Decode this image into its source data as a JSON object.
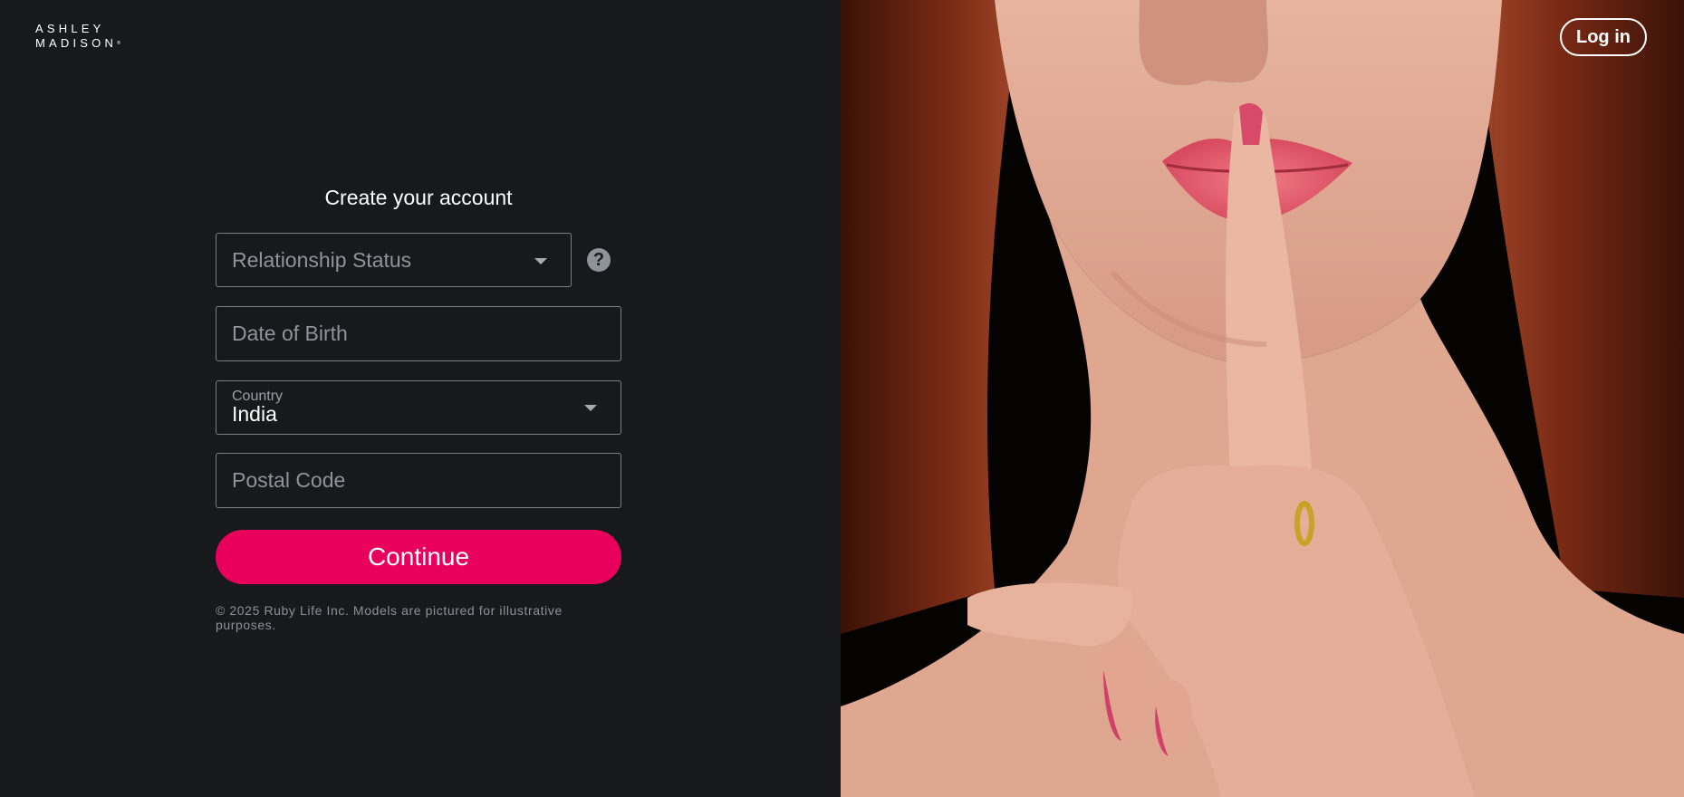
{
  "brand": {
    "logo_line1": "ASHLEY",
    "logo_line2": "MADISON",
    "logo_mark": "®"
  },
  "header": {
    "login_label": "Log in"
  },
  "form": {
    "title": "Create your account",
    "relationship_status": {
      "placeholder": "Relationship Status"
    },
    "help_icon_glyph": "?",
    "date_of_birth": {
      "placeholder": "Date of Birth"
    },
    "country": {
      "label": "Country",
      "value": "India"
    },
    "postal_code": {
      "placeholder": "Postal Code"
    },
    "continue_label": "Continue"
  },
  "footer": {
    "note": "© 2025 Ruby Life Inc. Models are pictured for illustrative purposes."
  },
  "colors": {
    "background": "#17191d",
    "accent": "#e8005c",
    "field_border": "#7a7f87"
  }
}
